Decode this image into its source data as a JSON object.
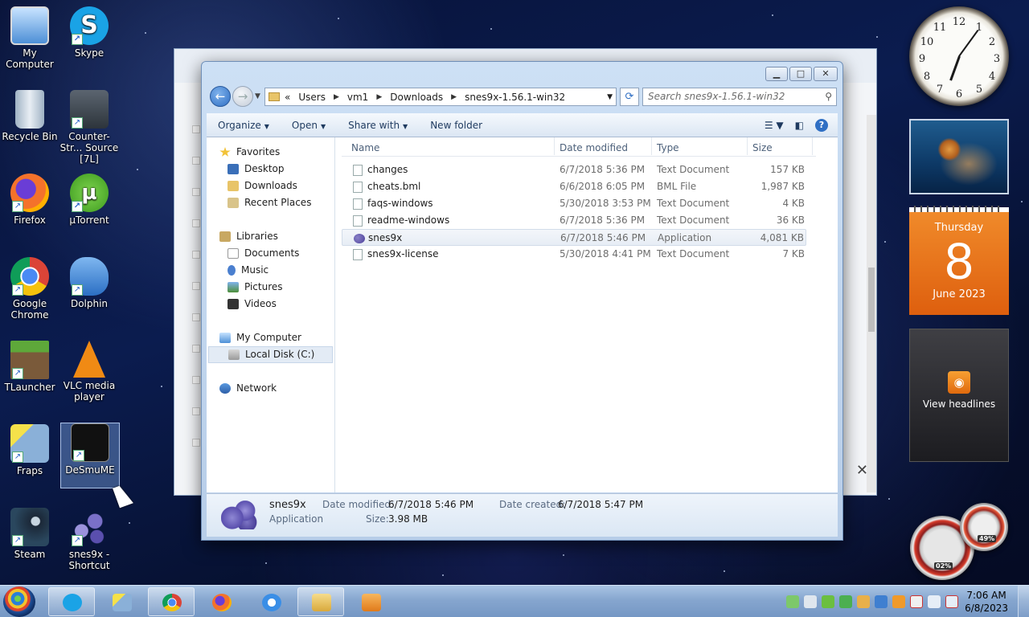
{
  "desktop": {
    "icons": [
      {
        "label": "My Computer"
      },
      {
        "label": "Skype"
      },
      {
        "label": "Recycle Bin"
      },
      {
        "label": "Counter-Str... Source [7L]"
      },
      {
        "label": "Firefox"
      },
      {
        "label": "µTorrent"
      },
      {
        "label": "Google Chrome"
      },
      {
        "label": "Dolphin"
      },
      {
        "label": "TLauncher"
      },
      {
        "label": "VLC media player"
      },
      {
        "label": "Fraps"
      },
      {
        "label": "DeSmuME"
      },
      {
        "label": "Steam"
      },
      {
        "label": "snes9x - Shortcut"
      }
    ]
  },
  "explorer": {
    "breadcrumb": [
      "Users",
      "vm1",
      "Downloads",
      "snes9x-1.56.1-win32"
    ],
    "breadcrumb_prefix": "«",
    "search_placeholder": "Search snes9x-1.56.1-win32",
    "toolbar": {
      "organize": "Organize",
      "open": "Open",
      "share_with": "Share with",
      "new_folder": "New folder"
    },
    "nav": {
      "favorites": "Favorites",
      "desktop": "Desktop",
      "downloads": "Downloads",
      "recent_places": "Recent Places",
      "libraries": "Libraries",
      "documents": "Documents",
      "music": "Music",
      "pictures": "Pictures",
      "videos": "Videos",
      "my_computer": "My Computer",
      "local_disk": "Local Disk (C:)",
      "network": "Network"
    },
    "columns": {
      "name": "Name",
      "date_modified": "Date modified",
      "type": "Type",
      "size": "Size"
    },
    "files": [
      {
        "name": "changes",
        "date": "6/7/2018 5:36 PM",
        "type": "Text Document",
        "size": "157 KB"
      },
      {
        "name": "cheats.bml",
        "date": "6/6/2018 6:05 PM",
        "type": "BML File",
        "size": "1,987 KB"
      },
      {
        "name": "faqs-windows",
        "date": "5/30/2018 3:53 PM",
        "type": "Text Document",
        "size": "4 KB"
      },
      {
        "name": "readme-windows",
        "date": "6/7/2018 5:36 PM",
        "type": "Text Document",
        "size": "36 KB"
      },
      {
        "name": "snes9x",
        "date": "6/7/2018 5:46 PM",
        "type": "Application",
        "size": "4,081 KB"
      },
      {
        "name": "snes9x-license",
        "date": "5/30/2018 4:41 PM",
        "type": "Text Document",
        "size": "7 KB"
      }
    ],
    "details": {
      "name": "snes9x",
      "type": "Application",
      "date_modified_label": "Date modified:",
      "date_modified": "6/7/2018 5:46 PM",
      "date_created_label": "Date created:",
      "date_created": "6/7/2018 5:47 PM",
      "size_label": "Size:",
      "size": "3.98 MB"
    }
  },
  "gadgets": {
    "clock_numbers": [
      "12",
      "1",
      "2",
      "3",
      "4",
      "5",
      "6",
      "7",
      "8",
      "9",
      "10",
      "11"
    ],
    "calendar": {
      "day": "Thursday",
      "date": "8",
      "month": "June 2023"
    },
    "feeds": {
      "label": "View headlines"
    },
    "cpu_percent": "02%",
    "ram_percent": "49%"
  },
  "taskbar": {
    "time": "7:06 AM",
    "date": "6/8/2023"
  }
}
